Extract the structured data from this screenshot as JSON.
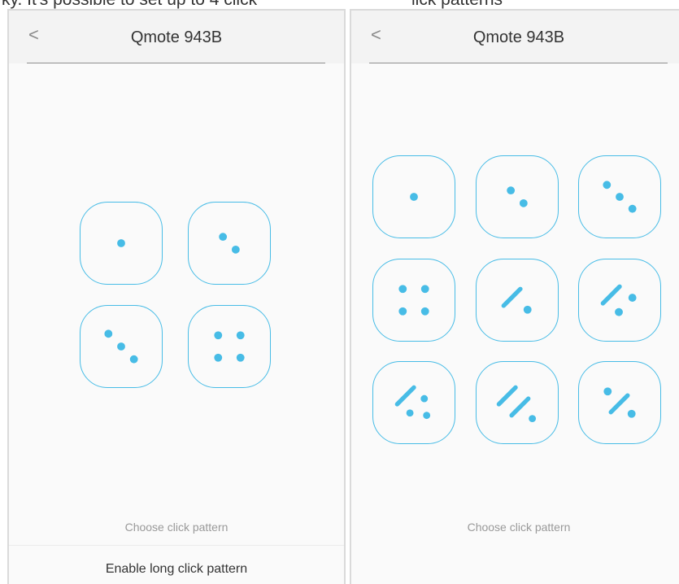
{
  "colors": {
    "accent": "#47bce6",
    "header_bg": "#f3f3f3",
    "screen_bg": "#fafafa",
    "hint_text": "#999999"
  },
  "top_crop": {
    "left_caption": "ky. It's possible to set up to 4 click",
    "right_caption": "lick patterns"
  },
  "left_screen": {
    "header": {
      "back_icon": "chevron-left-icon",
      "back_glyph": "<",
      "title": "Qmote 943B"
    },
    "patterns": [
      {
        "name": "1 click"
      },
      {
        "name": "2 clicks"
      },
      {
        "name": "3 clicks"
      },
      {
        "name": "4 clicks"
      }
    ],
    "hint": "Choose click pattern",
    "long_click_button": "Enable long click pattern"
  },
  "right_screen": {
    "header": {
      "back_icon": "chevron-left-icon",
      "back_glyph": "<",
      "title": "Qmote 943B"
    },
    "patterns": [
      {
        "name": "1 click"
      },
      {
        "name": "2 clicks"
      },
      {
        "name": "3 clicks"
      },
      {
        "name": "4 clicks"
      },
      {
        "name": "long + 1 click"
      },
      {
        "name": "long + 2 clicks"
      },
      {
        "name": "long + 3 clicks"
      },
      {
        "name": "2 long + 1 click"
      },
      {
        "name": "1 click + long + 1 click"
      }
    ],
    "hint": "Choose click pattern"
  }
}
